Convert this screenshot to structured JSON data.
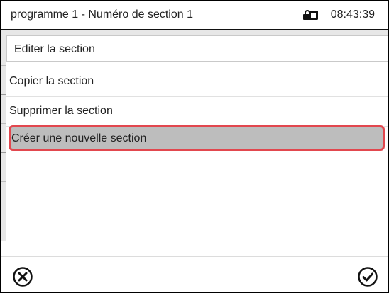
{
  "header": {
    "title": "programme 1 - Numéro de section 1",
    "time": "08:43:39",
    "lock_icon": "lock-icon"
  },
  "menu": {
    "items": [
      {
        "label": "Editer la section",
        "selected": false
      },
      {
        "label": "Copier la section",
        "selected": false
      },
      {
        "label": "Supprimer la section",
        "selected": false
      },
      {
        "label": "Créer une nouvelle section",
        "selected": true
      }
    ],
    "highlight_color": "#e2474e",
    "selected_background": "#bdbdbd"
  },
  "footer": {
    "cancel_icon": "close-circle-icon",
    "confirm_icon": "check-circle-icon"
  }
}
